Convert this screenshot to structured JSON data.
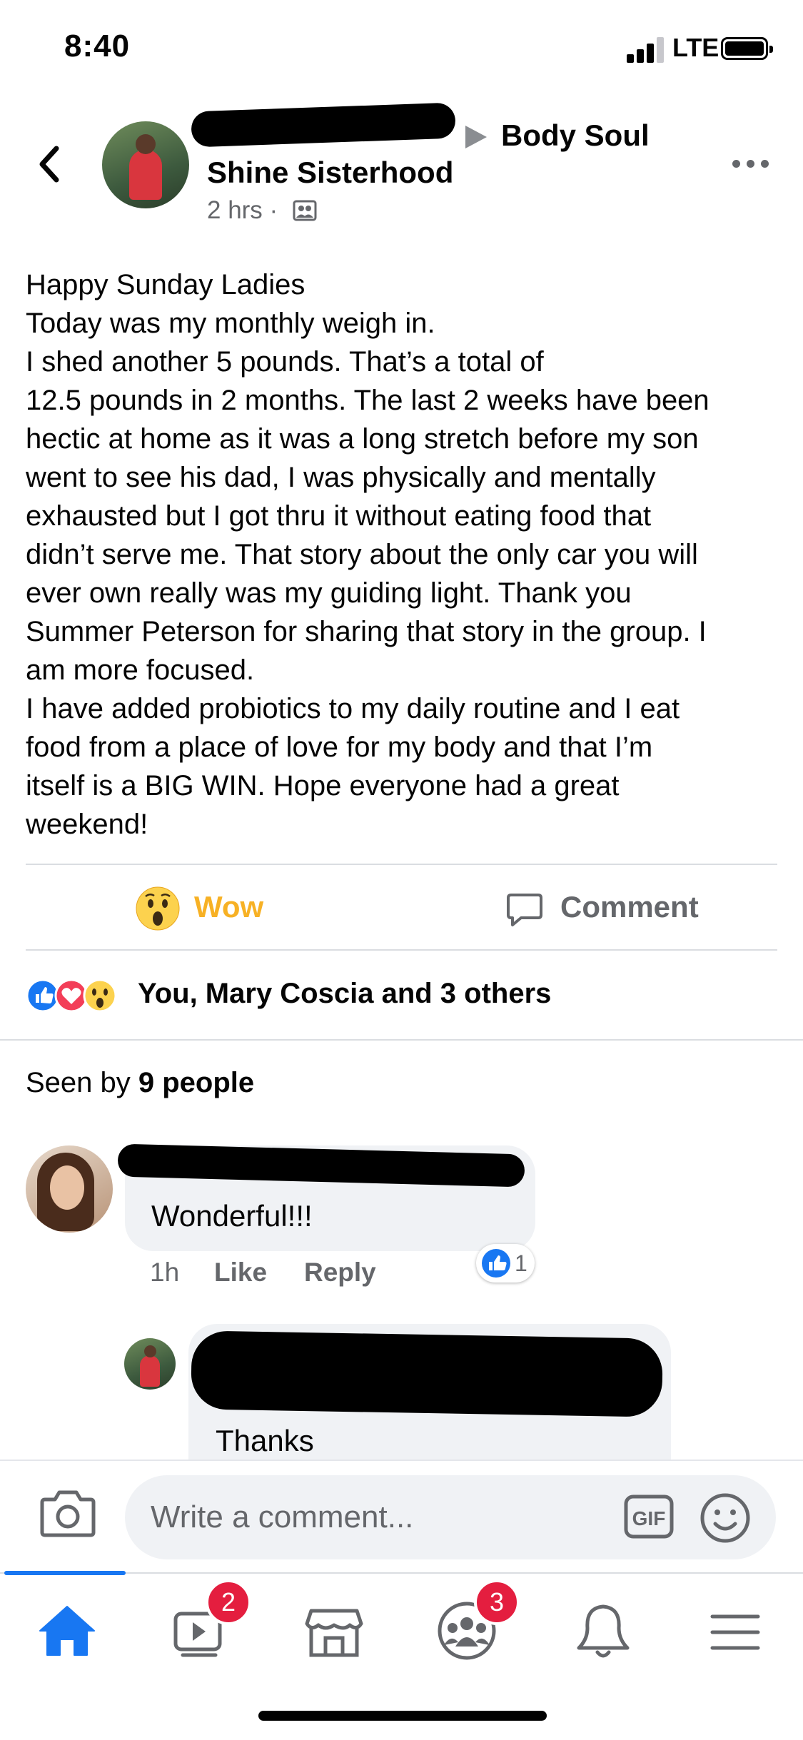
{
  "status_bar": {
    "time": "8:40",
    "network": "LTE"
  },
  "header": {
    "group_name_part1": "Body Soul",
    "group_name_part2": "Shine Sisterhood",
    "post_time": "2 hrs ·",
    "icons": {
      "back": "chevron-left-icon",
      "audience": "group-audience-icon",
      "more": "more-dots-icon"
    }
  },
  "post": {
    "lines": [
      "Happy Sunday Ladies",
      "Today was my monthly weigh in.",
      "I shed another 5 pounds. That’s a total of",
      "12.5 pounds in 2 months. The last 2 weeks have been",
      "hectic at home as it was a long stretch before my son",
      "went to see his dad, I was physically and mentally",
      "exhausted but I got thru it without eating food that",
      "didn’t serve me. That story about the only car you will",
      "ever own really was my guiding light. Thank you",
      "Summer Peterson for sharing that story in the group. I",
      "am more focused.",
      "I have added probiotics to my daily routine and I eat",
      "food from a place of love for my body and that I’m",
      "itself is a BIG WIN. Hope everyone had a great",
      "weekend!"
    ]
  },
  "actions": {
    "wow_label": "Wow",
    "comment_label": "Comment",
    "accent_wow": "#f7b125"
  },
  "reactions": {
    "summary": "You, Mary Coscia and 3 others",
    "types": [
      "like",
      "love",
      "wow"
    ]
  },
  "seen": {
    "prefix": "Seen by ",
    "count": "9 people"
  },
  "comments": [
    {
      "text": "Wonderful!!!",
      "time": "1h",
      "like": "Like",
      "reply": "Reply",
      "reaction_count": "1"
    },
    {
      "text": "Thanks"
    }
  ],
  "composer": {
    "placeholder": "Write a comment...",
    "gif_label": "GIF"
  },
  "tabbar": {
    "items": [
      "home-icon",
      "watch-icon",
      "marketplace-icon",
      "groups-icon",
      "notifications-icon",
      "menu-icon"
    ],
    "watch_badge": "2",
    "groups_badge": "3",
    "accent": "#1877f2"
  }
}
